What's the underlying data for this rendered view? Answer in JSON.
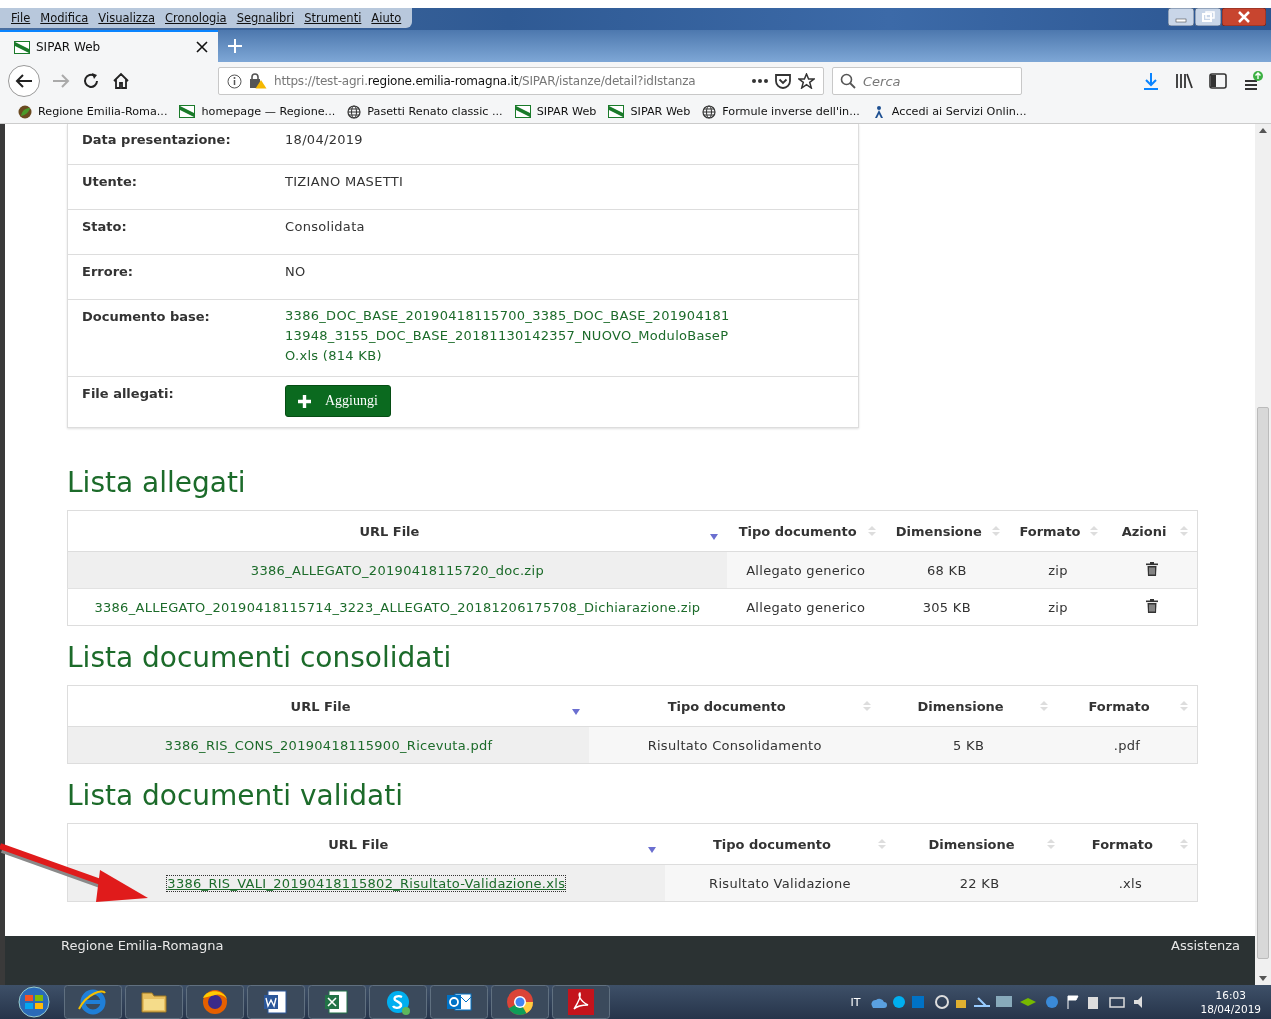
{
  "menu_bar": [
    "File",
    "Modifica",
    "Visualizza",
    "Cronologia",
    "Segnalibri",
    "Strumenti",
    "Aiuto"
  ],
  "tab": {
    "title": "SIPAR Web",
    "selected": true
  },
  "address": {
    "before": "https://test-agri.",
    "domain": "regione.emilia-romagna.it",
    "after": "/SIPAR/istanze/detail?idIstanza"
  },
  "search": {
    "placeholder": "Cerca"
  },
  "bookmarks": [
    {
      "kind": "leaf",
      "label": "Regione Emilia-Roma..."
    },
    {
      "kind": "flag",
      "label": "homepage — Regione..."
    },
    {
      "kind": "globe",
      "label": "Pasetti Renato classic ..."
    },
    {
      "kind": "flag",
      "label": "SIPAR Web"
    },
    {
      "kind": "flag",
      "label": "SIPAR Web"
    },
    {
      "kind": "globe",
      "label": "Formule inverse dell'in..."
    },
    {
      "kind": "person",
      "label": "Accedi ai Servizi Onlin..."
    }
  ],
  "details": [
    {
      "label": "Data presentazione:",
      "kind": "text",
      "value": "18/04/2019"
    },
    {
      "label": "Utente:",
      "kind": "text",
      "value": "TIZIANO MASETTI"
    },
    {
      "label": "Stato:",
      "kind": "text",
      "value": "Consolidata"
    },
    {
      "label": "Errore:",
      "kind": "text",
      "value": "NO"
    },
    {
      "label": "Documento base:",
      "kind": "link",
      "value": "3386_DOC_BASE_20190418115700_3385_DOC_BASE_20190418113948_3155_DOC_BASE_20181130142357_NUOVO_ModuloBasePO.xls (814 KB)"
    },
    {
      "label": "File allegati:",
      "kind": "button",
      "value": "Aggiungi"
    }
  ],
  "sections": [
    {
      "title": "Lista allegati",
      "columns": [
        {
          "label": "URL File",
          "sorted": true
        },
        {
          "label": "Tipo documento",
          "sorted": false
        },
        {
          "label": "Dimensione",
          "sorted": false
        },
        {
          "label": "Formato",
          "sorted": false
        },
        {
          "label": "Azioni",
          "sorted": false
        }
      ],
      "rows": [
        {
          "focused": false,
          "cells": [
            "3386_ALLEGATO_20190418115720_doc.zip",
            "Allegato generico",
            "68 KB",
            "zip"
          ],
          "deletable": true
        },
        {
          "focused": false,
          "cells": [
            "3386_ALLEGATO_20190418115714_3223_ALLEGATO_20181206175708_Dichiarazione.zip",
            "Allegato generico",
            "305 KB",
            "zip"
          ],
          "deletable": true
        }
      ]
    },
    {
      "title": "Lista documenti consolidati",
      "columns": [
        {
          "label": "URL File",
          "sorted": true
        },
        {
          "label": "Tipo documento",
          "sorted": false
        },
        {
          "label": "Dimensione",
          "sorted": false
        },
        {
          "label": "Formato",
          "sorted": false
        }
      ],
      "rows": [
        {
          "focused": false,
          "cells": [
            "3386_RIS_CONS_20190418115900_Ricevuta.pdf",
            "Risultato Consolidamento",
            "5 KB",
            ".pdf"
          ]
        }
      ]
    },
    {
      "title": "Lista documenti validati",
      "columns": [
        {
          "label": "URL File",
          "sorted": true
        },
        {
          "label": "Tipo documento",
          "sorted": false
        },
        {
          "label": "Dimensione",
          "sorted": false
        },
        {
          "label": "Formato",
          "sorted": false
        }
      ],
      "rows": [
        {
          "focused": true,
          "cells": [
            "3386_RIS_VALI_20190418115802_Risultato-Validazione.xls",
            "Risultato Validazione",
            "22 KB",
            ".xls"
          ]
        }
      ]
    }
  ],
  "footer": {
    "left": "Regione Emilia-Romagna",
    "right": "Assistenza"
  },
  "taskbar": {
    "apps": [
      {
        "kind": "ie"
      },
      {
        "kind": "folder"
      },
      {
        "kind": "firefox"
      },
      {
        "kind": "word"
      },
      {
        "kind": "excel"
      },
      {
        "kind": "skype"
      },
      {
        "kind": "outlook"
      },
      {
        "kind": "chrome"
      },
      {
        "kind": "pdf"
      }
    ],
    "language": "IT",
    "time": "16:03",
    "date": "18/04/2019"
  }
}
